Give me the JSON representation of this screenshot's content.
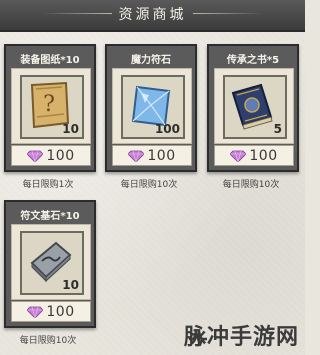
{
  "header": {
    "title": "资源商城"
  },
  "items": [
    {
      "name": "装备图纸*10",
      "icon": "scroll-map-icon",
      "quantity": "10",
      "price": "100",
      "limit": "每日限购1次"
    },
    {
      "name": "魔力符石",
      "icon": "blue-crystal-icon",
      "quantity": "100",
      "price": "100",
      "limit": "每日限购10次"
    },
    {
      "name": "传承之书*5",
      "icon": "ancient-book-icon",
      "quantity": "5",
      "price": "100",
      "limit": "每日限购10次"
    },
    {
      "name": "符文基石*10",
      "icon": "rune-stone-icon",
      "quantity": "10",
      "price": "100",
      "limit": "每日限购10次"
    }
  ],
  "watermark": {
    "text": "脉冲手游网"
  },
  "colors": {
    "gem": "#c77fd6",
    "card": "#5b5b5b",
    "banner": "#474747"
  }
}
